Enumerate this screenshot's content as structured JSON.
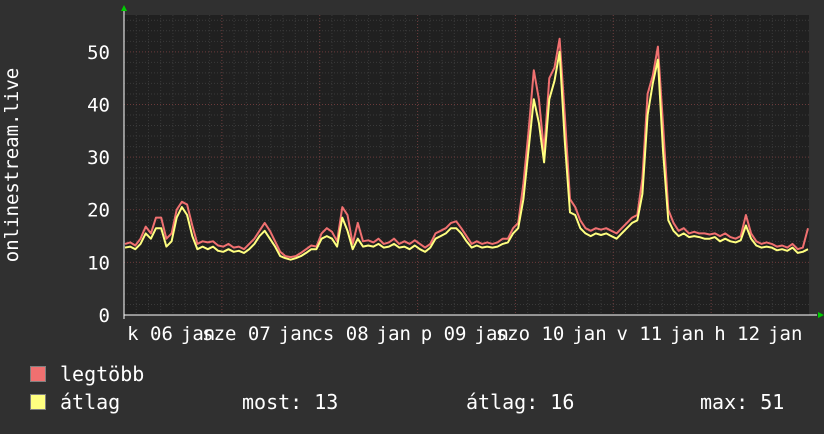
{
  "chart_data": {
    "type": "line",
    "ylabel": "onlinestream.live",
    "ylim": [
      0,
      57
    ],
    "yticks": [
      0,
      10,
      20,
      30,
      40,
      50
    ],
    "x_tick_labels": [
      "k 06",
      "jan",
      "sze 07",
      "jan",
      "cs 08",
      "jan",
      "p 09",
      "jan",
      "szo 10",
      "jan",
      "v 11",
      "jan",
      "h 12",
      "jan"
    ],
    "colors": {
      "background": "#303030",
      "plot_bg": "#202020",
      "grid": "#6a3a3a",
      "max": "#f07070",
      "avg": "#ffff80"
    },
    "grid": true,
    "series": [
      {
        "name": "legtöbb",
        "color": "#f07070",
        "values": [
          13.5,
          13.8,
          13.2,
          14.5,
          16.8,
          15.5,
          18.5,
          18.5,
          14.5,
          15.5,
          20.0,
          21.5,
          21.0,
          17.0,
          13.5,
          14.0,
          13.8,
          14.0,
          13.2,
          13.0,
          13.5,
          12.8,
          13.0,
          12.5,
          13.5,
          14.5,
          16.0,
          17.5,
          16.0,
          14.0,
          12.0,
          11.2,
          11.0,
          11.2,
          11.8,
          12.5,
          13.2,
          13.0,
          15.5,
          16.5,
          15.8,
          14.0,
          20.5,
          19.0,
          13.5,
          17.5,
          14.0,
          14.2,
          13.8,
          14.5,
          13.5,
          13.8,
          14.5,
          13.5,
          14.0,
          13.5,
          14.2,
          13.5,
          12.8,
          13.5,
          15.5,
          16.0,
          16.5,
          17.5,
          17.8,
          16.5,
          15.0,
          13.5,
          14.0,
          13.5,
          13.8,
          13.5,
          13.8,
          14.5,
          14.5,
          16.5,
          17.5,
          25.0,
          35.0,
          46.5,
          41.0,
          31.0,
          45.0,
          47.0,
          52.5,
          38.0,
          22.0,
          20.5,
          18.0,
          16.5,
          16.0,
          16.5,
          16.2,
          16.5,
          16.0,
          15.5,
          16.5,
          17.5,
          18.5,
          19.0,
          26.0,
          42.0,
          45.5,
          51.0,
          36.0,
          20.0,
          17.5,
          16.0,
          16.5,
          15.5,
          15.8,
          15.5,
          15.5,
          15.3,
          15.5,
          15.0,
          15.5,
          14.8,
          14.5,
          15.0,
          19.0,
          15.5,
          14.0,
          13.5,
          13.8,
          13.5,
          13.0,
          13.2,
          12.8,
          13.5,
          12.5,
          12.8,
          16.5
        ],
        "xlabel": "",
        "unit": ""
      },
      {
        "name": "átlag",
        "color": "#ffff80",
        "values": [
          12.8,
          13.0,
          12.5,
          13.5,
          15.5,
          14.5,
          16.5,
          16.5,
          13.0,
          14.0,
          18.5,
          20.5,
          19.0,
          15.0,
          12.5,
          13.0,
          12.5,
          13.0,
          12.2,
          12.0,
          12.5,
          12.0,
          12.2,
          11.8,
          12.5,
          13.5,
          15.0,
          16.0,
          14.5,
          13.0,
          11.2,
          10.8,
          10.5,
          10.8,
          11.2,
          11.8,
          12.5,
          12.5,
          14.5,
          15.0,
          14.5,
          13.0,
          18.5,
          16.0,
          12.5,
          14.5,
          13.0,
          13.2,
          13.0,
          13.5,
          12.8,
          13.0,
          13.5,
          12.8,
          13.0,
          12.5,
          13.2,
          12.5,
          12.0,
          12.8,
          14.5,
          15.0,
          15.5,
          16.5,
          16.5,
          15.5,
          14.0,
          12.8,
          13.2,
          12.8,
          13.0,
          12.8,
          13.0,
          13.5,
          13.8,
          15.5,
          16.5,
          22.0,
          31.5,
          41.0,
          36.5,
          29.0,
          41.0,
          44.5,
          50.0,
          33.0,
          19.5,
          19.0,
          16.5,
          15.5,
          15.0,
          15.5,
          15.2,
          15.5,
          15.0,
          14.5,
          15.5,
          16.5,
          17.5,
          18.0,
          23.0,
          38.0,
          44.0,
          48.5,
          31.0,
          18.0,
          16.0,
          15.0,
          15.5,
          14.8,
          15.0,
          14.8,
          14.5,
          14.5,
          14.8,
          14.0,
          14.5,
          14.0,
          13.8,
          14.2,
          17.0,
          14.5,
          13.2,
          12.8,
          13.0,
          12.8,
          12.3,
          12.5,
          12.2,
          12.8,
          11.8,
          12.0,
          12.5
        ],
        "xlabel": "",
        "unit": ""
      }
    ]
  },
  "legend": {
    "max_label": "legtöbb",
    "avg_label": "átlag"
  },
  "stats": {
    "now": "most: 13",
    "avg": "átlag: 16",
    "max": "max: 51"
  }
}
